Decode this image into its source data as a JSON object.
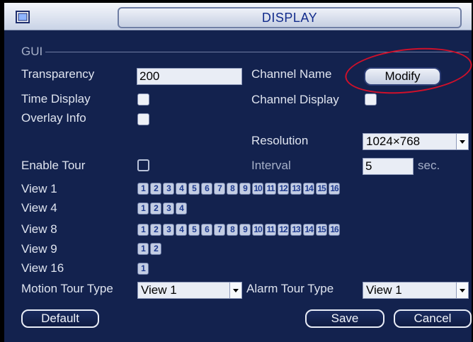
{
  "window": {
    "title": "DISPLAY"
  },
  "gui": {
    "section_label": "GUI"
  },
  "fields": {
    "transparency_label": "Transparency",
    "transparency_value": "200",
    "channel_name_label": "Channel Name",
    "modify_label": "Modify",
    "time_display_label": "Time Display",
    "channel_display_label": "Channel Display",
    "overlay_info_label": "Overlay Info",
    "resolution_label": "Resolution",
    "resolution_value": "1024×768",
    "enable_tour_label": "Enable Tour",
    "interval_label": "Interval",
    "interval_value": "5",
    "interval_unit": "sec."
  },
  "views": [
    {
      "label": "View 1",
      "channels": [
        "1",
        "2",
        "3",
        "4",
        "5",
        "6",
        "7",
        "8",
        "9",
        "10",
        "11",
        "12",
        "13",
        "14",
        "15",
        "16"
      ]
    },
    {
      "label": "View 4",
      "channels": [
        "1",
        "2",
        "3",
        "4"
      ]
    },
    {
      "label": "View 8",
      "channels": [
        "1",
        "2",
        "3",
        "4",
        "5",
        "6",
        "7",
        "8",
        "9",
        "10",
        "11",
        "12",
        "13",
        "14",
        "15",
        "16"
      ]
    },
    {
      "label": "View 9",
      "channels": [
        "1",
        "2"
      ]
    },
    {
      "label": "View 16",
      "channels": [
        "1"
      ]
    }
  ],
  "tour": {
    "motion_label": "Motion Tour Type",
    "motion_value": "View 1",
    "alarm_label": "Alarm Tour Type",
    "alarm_value": "View 1"
  },
  "buttons": {
    "default": "Default",
    "save": "Save",
    "cancel": "Cancel"
  },
  "colors": {
    "panel_bg": "#13224e",
    "title_text": "#122c8c",
    "highlight_ellipse": "#d0102a"
  }
}
